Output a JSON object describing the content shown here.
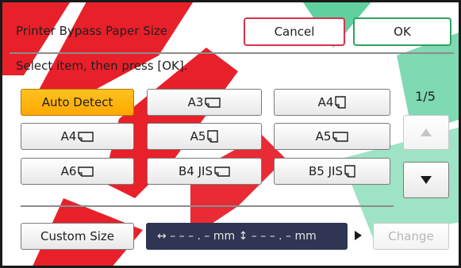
{
  "header": {
    "title": "Printer Bypass Paper Size",
    "cancel_label": "Cancel",
    "ok_label": "OK"
  },
  "instruction": "Select item, then press [OK].",
  "page_indicator": "1/5",
  "paper_sizes": [
    {
      "label": "Auto Detect",
      "glyph": "",
      "selected": true
    },
    {
      "label": "A3",
      "glyph": "paper-landscape-icon",
      "selected": false
    },
    {
      "label": "A4",
      "glyph": "paper-portrait-icon",
      "selected": false
    },
    {
      "label": "A4",
      "glyph": "paper-landscape-icon",
      "selected": false
    },
    {
      "label": "A5",
      "glyph": "paper-portrait-icon",
      "selected": false
    },
    {
      "label": "A5",
      "glyph": "paper-landscape-icon",
      "selected": false
    },
    {
      "label": "A6",
      "glyph": "paper-landscape-icon",
      "selected": false
    },
    {
      "label": "B4 JIS",
      "glyph": "paper-landscape-icon",
      "selected": false
    },
    {
      "label": "B5 JIS",
      "glyph": "paper-portrait-icon",
      "selected": false
    }
  ],
  "custom_size": {
    "button_label": "Custom Size",
    "size_text": "↔ – – – . – mm   ↕ – – – . – mm",
    "change_label": "Change"
  },
  "scroll": {
    "up_icon": "triangle-up-icon",
    "down_icon": "triangle-down-icon",
    "up_enabled": false,
    "down_enabled": true
  },
  "colors": {
    "selected": "#ffb000",
    "cancel_border": "#d8334b",
    "ok_border": "#2fa160",
    "display_bg": "#2f3553"
  }
}
